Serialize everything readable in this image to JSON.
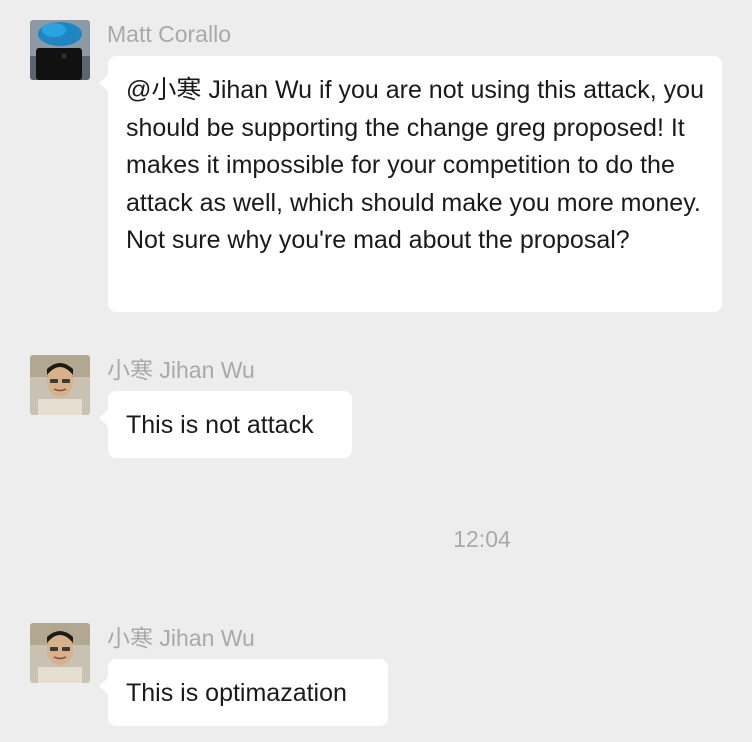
{
  "messages": [
    {
      "sender": "Matt Corallo",
      "text": "@小寒 Jihan Wu if you are not using this attack, you should be supporting the change greg proposed! It makes it impossible for your competition to do the attack as well, which should make you more money. Not sure why you're mad about the proposal?"
    },
    {
      "sender": "小寒 Jihan Wu",
      "text": "This is not attack"
    },
    {
      "sender": "小寒 Jihan Wu",
      "text": "This is optimazation"
    }
  ],
  "timestamp": "12:04",
  "colors": {
    "background": "#ededed",
    "bubble": "#ffffff",
    "sender_name": "#a9a9a9",
    "message_text": "#1a1a1a"
  }
}
